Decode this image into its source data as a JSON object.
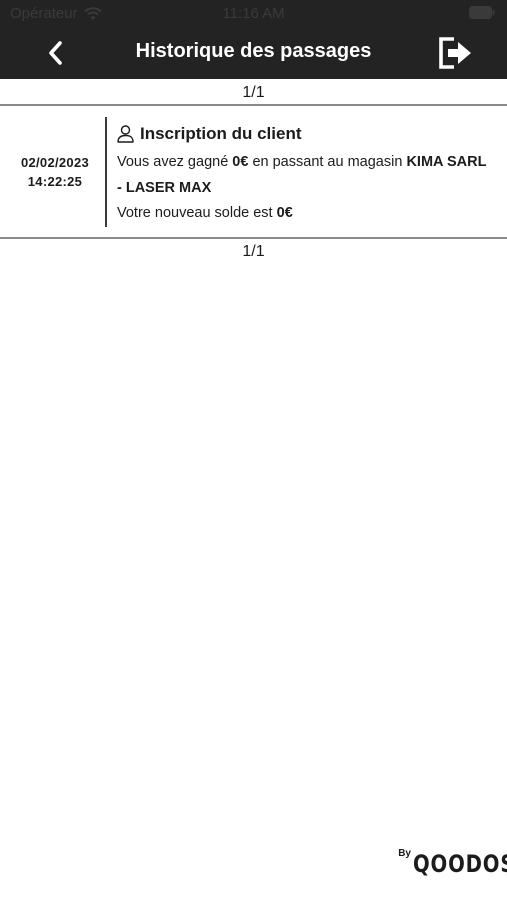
{
  "status_bar": {
    "carrier": "Opérateur",
    "time": "11:16 AM"
  },
  "header": {
    "title": "Historique des passages",
    "back_icon": "chevron-left-icon",
    "logout_icon": "logout-icon"
  },
  "pagination": {
    "top": "1/1",
    "bottom": "1/1"
  },
  "entries": [
    {
      "date": "02/02/2023",
      "time": "14:22:25",
      "icon": "user-icon",
      "title": "Inscription du client",
      "line1_prefix": "Vous avez gagné ",
      "amount_earned": "0€",
      "line1_mid": " en passant au magasin ",
      "store": "KIMA SARL - LASER MAX",
      "line2_prefix": "Votre nouveau solde est ",
      "balance": "0€"
    }
  ],
  "footer": {
    "by": "By",
    "brand": "QOODOS"
  },
  "colors": {
    "header_bg": "#232323",
    "text": "#1c1c1c",
    "divider": "#8a8a8a"
  }
}
